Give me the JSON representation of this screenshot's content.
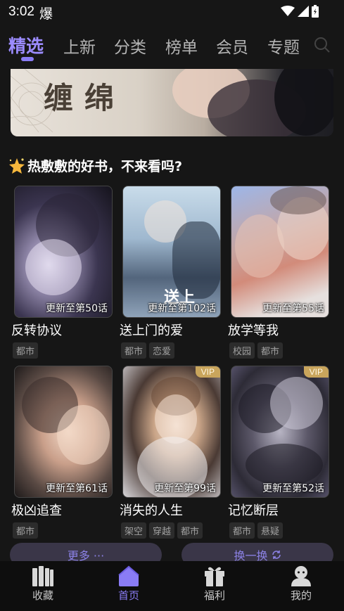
{
  "status_bar": {
    "time": "3:02",
    "app_icon": "爆"
  },
  "tabs": [
    {
      "label": "精选",
      "active": true
    },
    {
      "label": "上新"
    },
    {
      "label": "分类"
    },
    {
      "label": "榜单"
    },
    {
      "label": "会员"
    },
    {
      "label": "专题"
    }
  ],
  "banner": {
    "title": "缠绵"
  },
  "section": {
    "title": "热敷敷的好书，不来看吗?",
    "icon": "sparkle-star-icon"
  },
  "books": [
    {
      "name": "反转协议",
      "update": "更新至第50话",
      "tags": [
        "都市"
      ],
      "vip": false
    },
    {
      "name": "送上门的爱",
      "update": "更新至第102话",
      "tags": [
        "都市",
        "恋爱"
      ],
      "vip": false
    },
    {
      "name": "放学等我",
      "update": "更新至第55话",
      "tags": [
        "校园",
        "都市"
      ],
      "vip": false
    },
    {
      "name": "极凶追查",
      "update": "更新至第61话",
      "tags": [
        "都市"
      ],
      "vip": false
    },
    {
      "name": "消失的人生",
      "update": "更新至第99话",
      "tags": [
        "架空",
        "穿越",
        "都市"
      ],
      "vip": true
    },
    {
      "name": "记忆断层",
      "update": "更新至第52话",
      "tags": [
        "都市",
        "悬疑"
      ],
      "vip": true
    }
  ],
  "vip_label": "VIP",
  "cover_text_2": "送上",
  "buttons": {
    "more": "更多 ···",
    "refresh": "换一换"
  },
  "nav": [
    {
      "label": "收藏",
      "icon": "bookshelf-icon"
    },
    {
      "label": "首页",
      "icon": "home-icon",
      "active": true
    },
    {
      "label": "福利",
      "icon": "gift-icon"
    },
    {
      "label": "我的",
      "icon": "profile-icon"
    }
  ],
  "colors": {
    "accent": "#8a7cf5",
    "background": "#161616",
    "vip": "#c9a55c"
  }
}
